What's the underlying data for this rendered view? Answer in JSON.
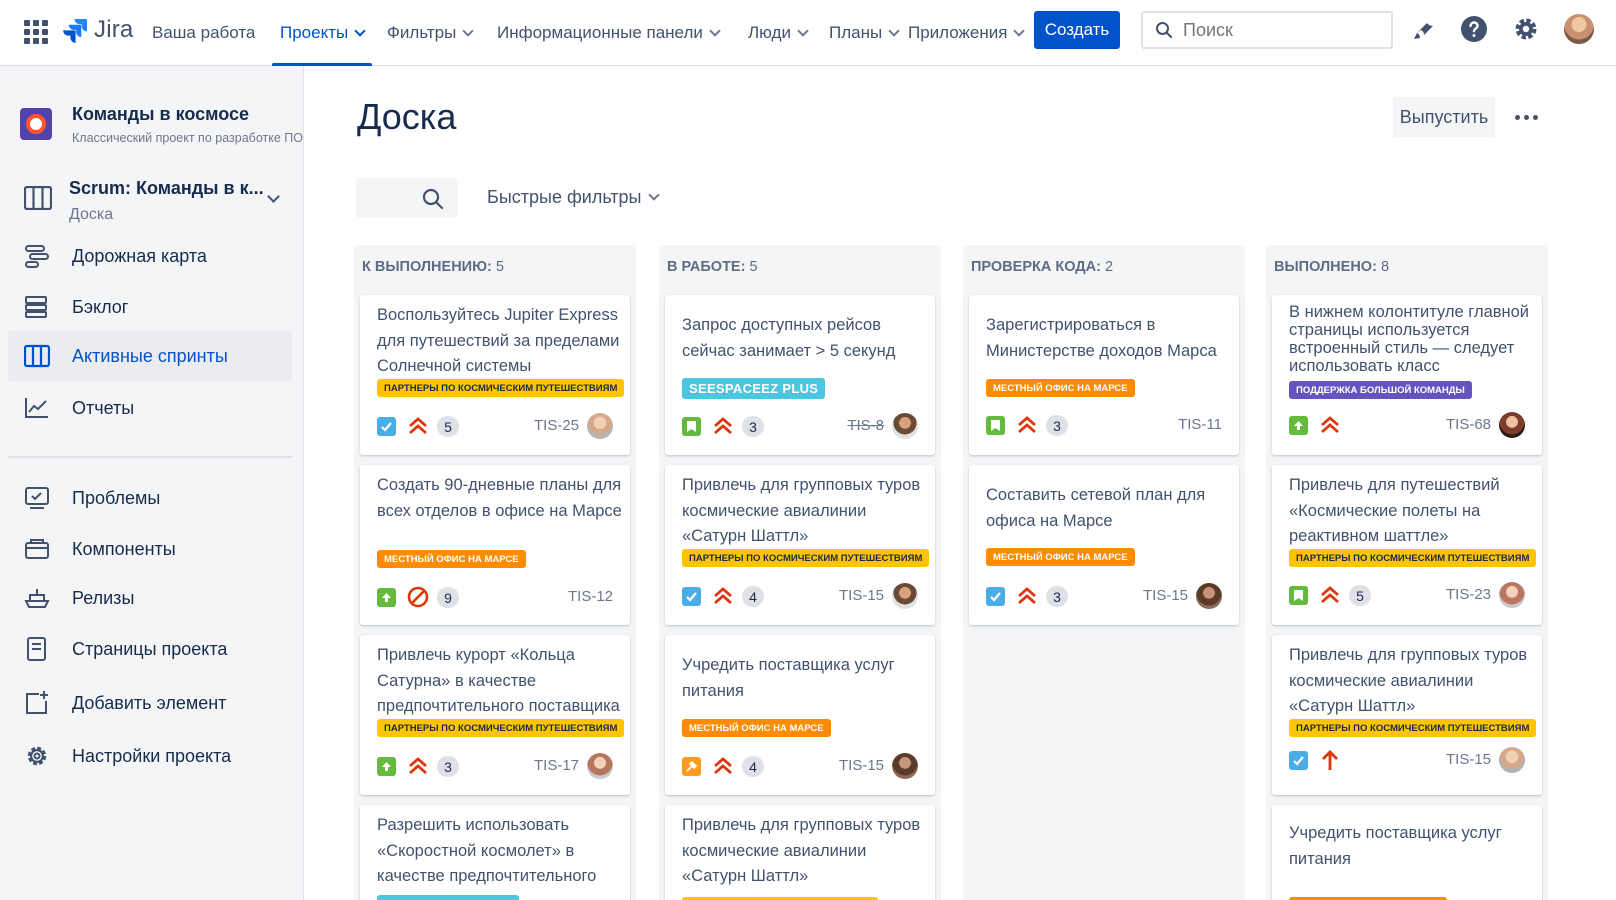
{
  "topnav": {
    "logo": "Jira",
    "items": [
      {
        "label": "Ваша работа",
        "dropdown": false
      },
      {
        "label": "Проекты",
        "dropdown": true
      },
      {
        "label": "Фильтры",
        "dropdown": true
      },
      {
        "label": "Информационные панели",
        "dropdown": true
      },
      {
        "label": "Люди",
        "dropdown": true
      },
      {
        "label": "Планы",
        "dropdown": true
      },
      {
        "label": "Приложения",
        "dropdown": true
      }
    ],
    "active": "Проекты",
    "create_label": "Создать",
    "search_placeholder": "Поиск",
    "accent": "#0052cc"
  },
  "sidebar": {
    "project_name": "Команды в космосе",
    "project_type": "Классический проект по разработке ПО",
    "board_name": "Scrum: Команды в к...",
    "board_sub": "Доска",
    "items": [
      {
        "label": "Дорожная карта",
        "icon": "roadmap-icon"
      },
      {
        "label": "Бэклог",
        "icon": "backlog-icon"
      },
      {
        "label": "Активные спринты",
        "icon": "board-icon",
        "active": true
      },
      {
        "label": "Отчеты",
        "icon": "chart-icon"
      },
      {
        "label": "Проблемы",
        "icon": "issues-icon"
      },
      {
        "label": "Компоненты",
        "icon": "components-icon"
      },
      {
        "label": "Релизы",
        "icon": "ship-icon"
      },
      {
        "label": "Страницы проекта",
        "icon": "page-icon"
      },
      {
        "label": "Добавить элемент",
        "icon": "add-item-icon"
      },
      {
        "label": "Настройки проекта",
        "icon": "gear-icon"
      }
    ]
  },
  "main": {
    "title": "Доска",
    "release_label": "Выпустить",
    "quick_filters": "Быстрые фильтры"
  },
  "columns": [
    {
      "name": "К ВЫПОЛНЕНИЮ:",
      "count": "5",
      "cards": [
        {
          "title": "Воспользуйтесь Jupiter Express для путешествий за пределами Солнечной системы",
          "label": "партнеры по космическим путешествиям",
          "label_color": "#ffc400",
          "type": "task",
          "priority": "highest",
          "points": "5",
          "key": "TIS-25"
        },
        {
          "title": "Создать 90-дневные планы для всех отделов в офисе на Марсе",
          "label": "местный офис на Марсе",
          "label_color": "#ff8b00",
          "type": "improvement",
          "priority": "blocker",
          "points": "9",
          "key": "TIS-12"
        },
        {
          "title": "Привлечь курорт «Кольца Сатурна» в качестве предпочтительного поставщика",
          "label": "партнеры по космическим путешествиям",
          "label_color": "#ffc400",
          "type": "improvement",
          "priority": "highest",
          "points": "3",
          "key": "TIS-17"
        },
        {
          "title": "Разрешить использовать «Скоростной космолет» в качестве предпочтительного",
          "label": "",
          "label_color": "#4bc6e0"
        }
      ]
    },
    {
      "name": "В РАБОТЕ:",
      "count": "5",
      "cards": [
        {
          "title": "Запрос доступных рейсов сейчас занимает > 5 секунд",
          "label": "SeeSpaceEZ Plus",
          "label_color": "#4bc6e0",
          "type": "story",
          "priority": "highest",
          "points": "3",
          "key": "TIS-8"
        },
        {
          "title": "Привлечь для групповых туров космические авиалинии «Сатурн Шаттл»",
          "label": "партнеры по космическим путешествиям",
          "label_color": "#ffc400",
          "type": "task",
          "priority": "highest",
          "points": "4",
          "key": "TIS-15"
        },
        {
          "title": "Учредить поставщика услуг питания",
          "label": "местный офис на Марсе",
          "label_color": "#ff8b00",
          "type": "bug",
          "priority": "highest",
          "points": "4",
          "key": "TIS-15"
        },
        {
          "title": "Привлечь для групповых туров космические авиалинии «Сатурн Шаттл»",
          "label": "",
          "label_color": "#ffc400"
        }
      ]
    },
    {
      "name": "ПРОВЕРКА КОДА:",
      "count": "2",
      "cards": [
        {
          "title": "Зарегистрироваться в Министерстве доходов Марса",
          "label": "местный офис на Марсе",
          "label_color": "#ff8b00",
          "type": "story",
          "priority": "highest",
          "points": "3",
          "key": "TIS-11"
        },
        {
          "title": "Составить сетевой план для офиса на Марсе",
          "label": "местный офис на Марсе",
          "label_color": "#ff8b00",
          "type": "task",
          "priority": "highest",
          "points": "3",
          "key": "TIS-15"
        }
      ]
    },
    {
      "name": "ВЫПОЛНЕНО:",
      "count": "8",
      "cards": [
        {
          "title": "В нижнем колонтитуле главной страницы используется встроенный стиль — следует использовать класс",
          "label": "поддержка большой команды",
          "label_color": "#6554c0",
          "type": "improvement",
          "priority": "highest",
          "points": "",
          "key": "TIS-68"
        },
        {
          "title": "Привлечь для путешествий «Космические полеты на реактивном шаттле»",
          "label": "партнеры по космическим путешествиям",
          "label_color": "#ffc400",
          "type": "story",
          "priority": "highest",
          "points": "5",
          "key": "TIS-23"
        },
        {
          "title": "Привлечь для групповых туров космические авиалинии «Сатурн Шаттл»",
          "label": "партнеры по космическим путешествиям",
          "label_color": "#ffc400",
          "type": "task",
          "priority": "high",
          "points": "",
          "key": "TIS-15"
        },
        {
          "title": "Учредить поставщика услуг питания",
          "label": "",
          "label_color": "#ff8b00"
        }
      ]
    }
  ]
}
